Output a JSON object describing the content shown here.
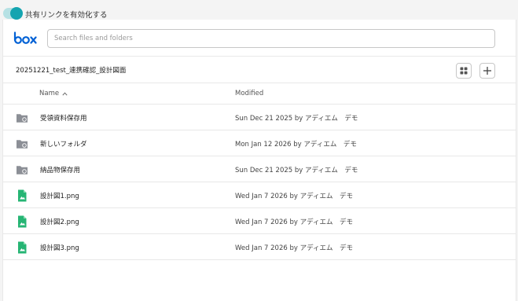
{
  "share_toggle": {
    "label": "共有リンクを有効化する",
    "enabled": true,
    "accent_color": "#14a4b0"
  },
  "header": {
    "logo_text": "box",
    "brand_color": "#0061d5",
    "search": {
      "placeholder": "Search files and folders",
      "value": ""
    }
  },
  "folder": {
    "breadcrumb": "20251221_test_連携確認_設計図面",
    "actions": [
      {
        "name": "grid-view",
        "icon": "grid-icon"
      },
      {
        "name": "add",
        "icon": "plus-icon"
      }
    ]
  },
  "columns": {
    "name": "Name",
    "modified": "Modified"
  },
  "items": [
    {
      "type": "folder",
      "icon": "shared-folder-icon",
      "name": "受領資料保存用",
      "modified": "Sun Dec 21 2025 by アディエム　デモ"
    },
    {
      "type": "folder",
      "icon": "shared-folder-icon",
      "name": "新しいフォルダ",
      "modified": "Mon Jan 12 2026 by アディエム　デモ"
    },
    {
      "type": "folder",
      "icon": "shared-folder-icon",
      "name": "納品物保存用",
      "modified": "Sun Dec 21 2025 by アディエム　デモ"
    },
    {
      "type": "image",
      "icon": "image-file-icon",
      "name": "設計図1.png",
      "modified": "Wed Jan 7 2026 by アディエム　デモ"
    },
    {
      "type": "image",
      "icon": "image-file-icon",
      "name": "設計図2.png",
      "modified": "Wed Jan 7 2026 by アディエム　デモ"
    },
    {
      "type": "image",
      "icon": "image-file-icon",
      "name": "設計図3.png",
      "modified": "Wed Jan 7 2026 by アディエム　デモ"
    }
  ]
}
